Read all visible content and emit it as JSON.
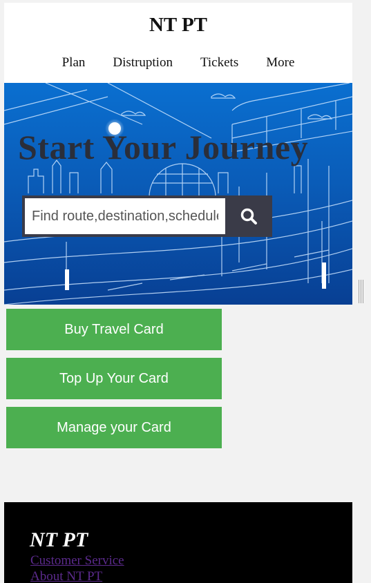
{
  "header": {
    "title": "NT PT",
    "nav": [
      "Plan",
      "Distruption",
      "Tickets",
      "More"
    ]
  },
  "hero": {
    "title": "Start Your Journey",
    "search_placeholder": "Find route,destination,schedule",
    "search_icon": "search-icon"
  },
  "actions": [
    "Buy Travel Card",
    "Top Up Your Card",
    "Manage your Card"
  ],
  "footer": {
    "title": "NT PT",
    "links": [
      "Customer Service",
      "About NT PT"
    ]
  },
  "colors": {
    "action_green": "#4caf50",
    "search_bar": "#3a3b48",
    "hero_blue": "#0a6fd0",
    "footer_bg": "#000000",
    "visited_link": "#5b2a8c"
  }
}
